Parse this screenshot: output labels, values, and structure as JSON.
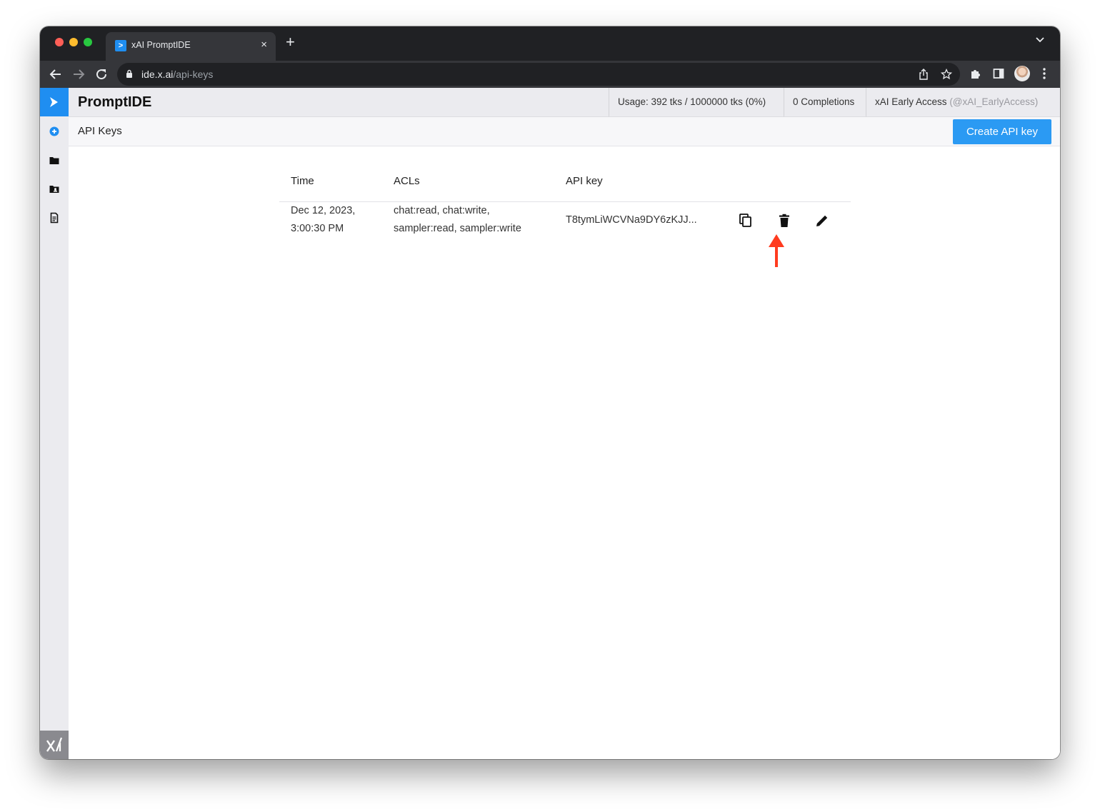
{
  "browser": {
    "tab_title": "xAI PromptIDE",
    "tab_favicon": ">",
    "tab_close": "×",
    "new_tab": "+",
    "url_host": "ide.x.ai",
    "url_path": "/api-keys"
  },
  "app": {
    "brand": "PromptIDE",
    "usage": "Usage: 392 tks / 1000000 tks (0%)",
    "completions": "0 Completions",
    "account_name": "xAI Early Access",
    "account_handle": "(@xAI_EarlyAccess)",
    "page_title": "API Keys",
    "create_button": "Create API key"
  },
  "table": {
    "headers": [
      "Time",
      "ACLs",
      "API key"
    ],
    "rows": [
      {
        "time_line1": "Dec 12, 2023,",
        "time_line2": "3:00:30 PM",
        "acls_line1": "chat:read, chat:write,",
        "acls_line2": "sampler:read, sampler:write",
        "api_key": "T8tymLiWCVNa9DY6zKJJ..."
      }
    ]
  },
  "colors": {
    "accent": "#1f8ef1",
    "button": "#2b9af3",
    "annotation_arrow": "#ff3b1f"
  },
  "icons": [
    "copy-icon",
    "trash-icon",
    "pencil-icon",
    "plus-circle-icon",
    "folder-icon",
    "shared-folder-icon",
    "document-icon",
    "xai-logo-icon"
  ]
}
